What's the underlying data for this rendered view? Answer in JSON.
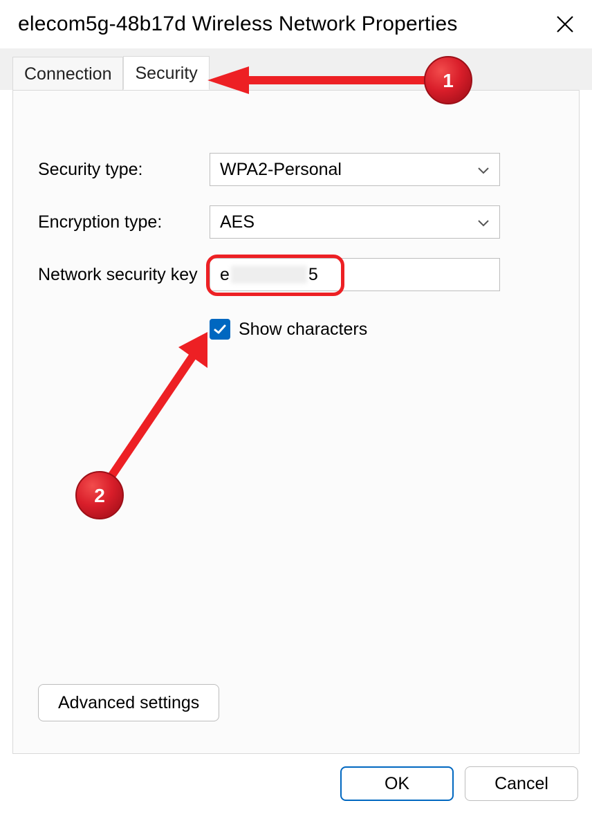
{
  "window": {
    "title": "elecom5g-48b17d Wireless Network Properties"
  },
  "tabs": {
    "connection": "Connection",
    "security": "Security"
  },
  "form": {
    "security_type_label": "Security type:",
    "security_type_value": "WPA2-Personal",
    "encryption_type_label": "Encryption type:",
    "encryption_type_value": "AES",
    "network_key_label": "Network security key",
    "network_key_prefix": "e",
    "network_key_suffix": "5",
    "show_characters_label": "Show characters",
    "advanced_settings": "Advanced settings"
  },
  "buttons": {
    "ok": "OK",
    "cancel": "Cancel"
  },
  "annotation": {
    "badge1": "1",
    "badge2": "2"
  }
}
